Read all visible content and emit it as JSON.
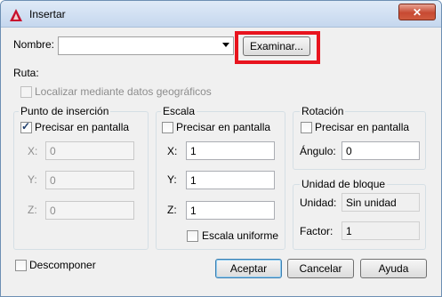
{
  "window": {
    "title": "Insertar",
    "close_label": "✕"
  },
  "name": {
    "label": "Nombre:",
    "value": ""
  },
  "browse_button": "Examinar...",
  "path": {
    "label": "Ruta:"
  },
  "geo_checkbox": {
    "label": "Localizar mediante datos geográficos",
    "checked": false
  },
  "insertion_point": {
    "title": "Punto de inserción",
    "on_screen": {
      "label": "Precisar en pantalla",
      "checked": true
    },
    "x_label": "X:",
    "x_value": "0",
    "y_label": "Y:",
    "y_value": "0",
    "z_label": "Z:",
    "z_value": "0"
  },
  "scale": {
    "title": "Escala",
    "on_screen": {
      "label": "Precisar en pantalla",
      "checked": false
    },
    "x_label": "X:",
    "x_value": "1",
    "y_label": "Y:",
    "y_value": "1",
    "z_label": "Z:",
    "z_value": "1",
    "uniform": {
      "label": "Escala uniforme",
      "checked": false
    }
  },
  "rotation": {
    "title": "Rotación",
    "on_screen": {
      "label": "Precisar en pantalla",
      "checked": false
    },
    "angle_label": "Ángulo:",
    "angle_value": "0"
  },
  "block_unit": {
    "title": "Unidad de bloque",
    "unit_label": "Unidad:",
    "unit_value": "Sin unidad",
    "factor_label": "Factor:",
    "factor_value": "1"
  },
  "explode": {
    "label": "Descomponer",
    "checked": false
  },
  "buttons": {
    "ok": "Aceptar",
    "cancel": "Cancelar",
    "help": "Ayuda"
  },
  "colors": {
    "highlight": "#e8141e",
    "app_icon": "#c8102e"
  },
  "icons": {
    "app": "autocad-a-icon",
    "close": "close-icon",
    "dropdown": "chevron-down-icon",
    "check": "checkmark-icon"
  }
}
